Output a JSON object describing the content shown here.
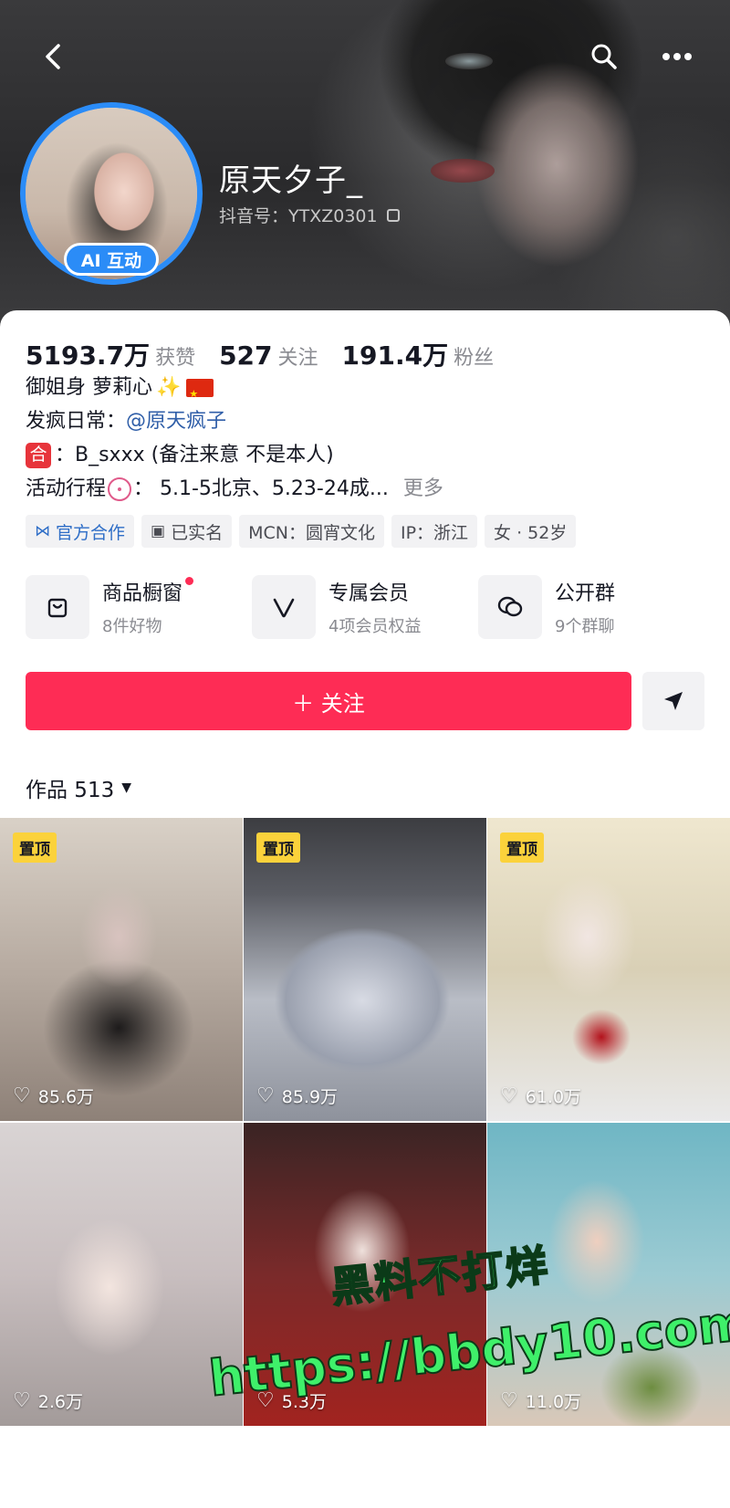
{
  "header": {
    "username": "原天夕子_",
    "douyin_id": "抖音号：YTXZ0301",
    "ai_badge": "AI 互动"
  },
  "stats": [
    {
      "value": "5193.7万",
      "label": "获赞"
    },
    {
      "value": "527",
      "label": "关注"
    },
    {
      "value": "191.4万",
      "label": "粉丝"
    }
  ],
  "bio": {
    "line1": "御姐身 萝莉心",
    "line2_prefix": "发疯日常：",
    "line2_mention": "@原天疯子",
    "line3_badge": "合",
    "line3_text": "：B_sxxx (备注来意 不是本人)",
    "line4_prefix": "活动行程",
    "line4_text": "：  5.1-5北京、5.23-24成...",
    "more": "更多"
  },
  "tags": [
    "官方合作",
    "已实名",
    "MCN：圆宵文化",
    "IP：浙江",
    "女 · 52岁"
  ],
  "features": [
    {
      "title": "商品橱窗",
      "sub": "8件好物",
      "icon": "shopping-bag-icon"
    },
    {
      "title": "专属会员",
      "sub": "4项会员权益",
      "icon": "v-icon"
    },
    {
      "title": "公开群",
      "sub": "9个群聊",
      "icon": "chat-bubble-icon"
    }
  ],
  "follow_label": "＋ 关注",
  "works": {
    "label": "作品 513"
  },
  "videos": [
    {
      "likes": "85.6万",
      "pinned": "置顶"
    },
    {
      "likes": "85.9万",
      "pinned": "置顶"
    },
    {
      "likes": "61.0万",
      "pinned": "置顶"
    },
    {
      "likes": "2.6万",
      "pinned": ""
    },
    {
      "likes": "5.3万",
      "pinned": ""
    },
    {
      "likes": "11.0万",
      "pinned": ""
    }
  ],
  "watermark": {
    "line1": "黑料不打烊",
    "line2": "https://bbdy10.com"
  },
  "colors": {
    "accent": "#fe2c55",
    "avatar_ring": "#2b8cf7",
    "pin": "#fbd23b",
    "watermark": "#3ff06a"
  }
}
